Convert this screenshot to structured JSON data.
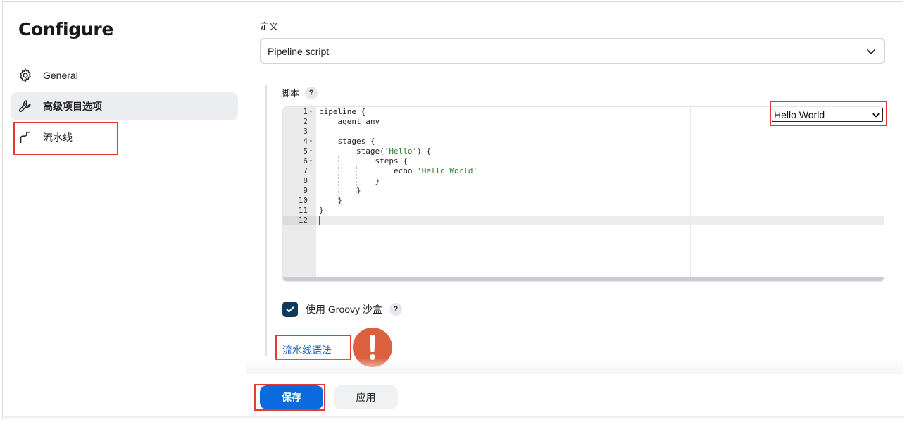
{
  "sidebar": {
    "title": "Configure",
    "items": [
      {
        "label": "General",
        "icon": "gear-icon"
      },
      {
        "label": "高级项目选项",
        "icon": "wrench-icon"
      },
      {
        "label": "流水线",
        "icon": "pipeline-icon"
      }
    ]
  },
  "definition": {
    "label": "定义",
    "selected": "Pipeline script"
  },
  "script": {
    "label": "脚本",
    "help": "?",
    "sample_selected": "Hello World",
    "lines": [
      {
        "n": "1",
        "fold": "▾",
        "code": "pipeline {"
      },
      {
        "n": "2",
        "fold": "",
        "code": "    agent any"
      },
      {
        "n": "3",
        "fold": "",
        "code": ""
      },
      {
        "n": "4",
        "fold": "▾",
        "code": "    stages {"
      },
      {
        "n": "5",
        "fold": "▾",
        "code": "        stage(",
        "str": "'Hello'",
        "rest": ") {"
      },
      {
        "n": "6",
        "fold": "▾",
        "code": "            steps {"
      },
      {
        "n": "7",
        "fold": "",
        "code": "                echo ",
        "str": "'Hello World'",
        "rest": ""
      },
      {
        "n": "8",
        "fold": "",
        "code": "            }"
      },
      {
        "n": "9",
        "fold": "",
        "code": "        }"
      },
      {
        "n": "10",
        "fold": "",
        "code": "    }"
      },
      {
        "n": "11",
        "fold": "",
        "code": "}"
      },
      {
        "n": "12",
        "fold": "",
        "code": ""
      }
    ]
  },
  "sandbox": {
    "label": "使用 Groovy 沙盒",
    "checked": true,
    "help": "?"
  },
  "syntax_link": "流水线语法",
  "footer": {
    "save": "保存",
    "apply": "应用"
  },
  "colors": {
    "accent": "#0b6bde",
    "checkbox": "#103a5c",
    "annotation": "#e53935",
    "warning": "#dc5f3e",
    "link": "#1460c6"
  }
}
